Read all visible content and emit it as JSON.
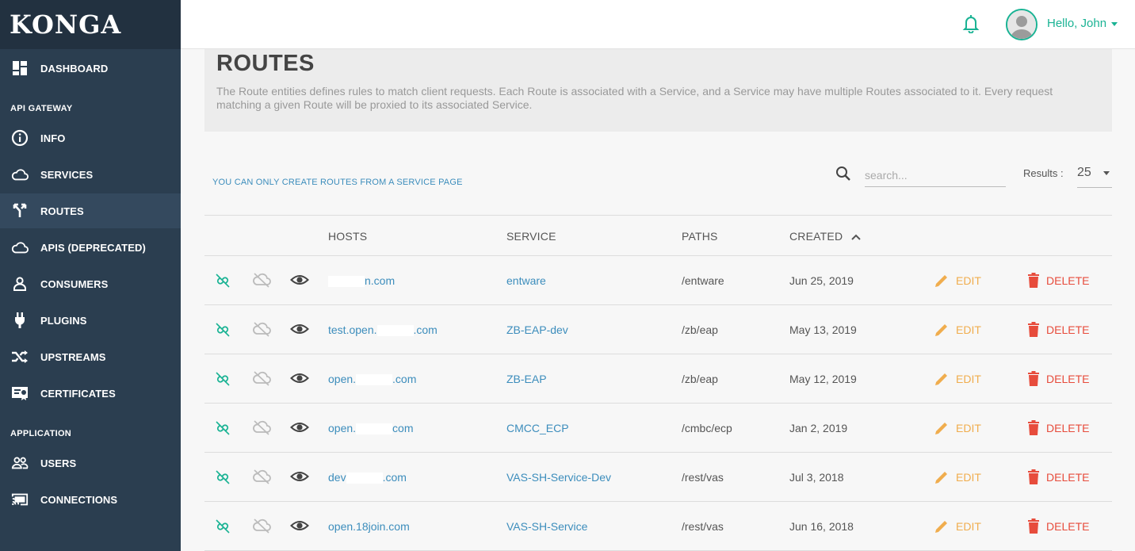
{
  "app": {
    "logo": "KONGA"
  },
  "sidebar": {
    "items": [
      {
        "label": "DASHBOARD",
        "icon": "dashboard-icon"
      },
      {
        "label": "INFO",
        "icon": "info-icon"
      },
      {
        "label": "SERVICES",
        "icon": "cloud-icon"
      },
      {
        "label": "ROUTES",
        "icon": "routes-icon",
        "active": true
      },
      {
        "label": "APIS (DEPRECATED)",
        "icon": "cloud-icon"
      },
      {
        "label": "CONSUMERS",
        "icon": "user-icon"
      },
      {
        "label": "PLUGINS",
        "icon": "plug-icon"
      },
      {
        "label": "UPSTREAMS",
        "icon": "shuffle-icon"
      },
      {
        "label": "CERTIFICATES",
        "icon": "certificate-icon"
      },
      {
        "label": "USERS",
        "icon": "users-icon"
      },
      {
        "label": "CONNECTIONS",
        "icon": "cast-icon"
      }
    ],
    "sections": {
      "api_gateway": "API GATEWAY",
      "application": "APPLICATION"
    }
  },
  "topbar": {
    "greeting": "Hello, John"
  },
  "page": {
    "title": "ROUTES",
    "description": "The Route entities defines rules to match client requests. Each Route is associated with a Service, and a Service may have multiple Routes associated to it. Every request matching a given Route will be proxied to its associated Service.",
    "notice": "YOU CAN ONLY CREATE ROUTES FROM A SERVICE PAGE"
  },
  "search": {
    "placeholder": "search..."
  },
  "results": {
    "label": "Results :",
    "value": "25"
  },
  "table": {
    "headers": {
      "hosts": "HOSTS",
      "service": "SERVICE",
      "paths": "PATHS",
      "created": "CREATED"
    },
    "edit_label": "EDIT",
    "delete_label": "DELETE",
    "rows": [
      {
        "host_pre": "",
        "host_post": "n.com",
        "service": "entware",
        "path": "/entware",
        "created": "Jun 25, 2019"
      },
      {
        "host_pre": "test.open.",
        "host_post": ".com",
        "service": "ZB-EAP-dev",
        "path": "/zb/eap",
        "created": "May 13, 2019"
      },
      {
        "host_pre": "open.",
        "host_post": ".com",
        "service": "ZB-EAP",
        "path": "/zb/eap",
        "created": "May 12, 2019"
      },
      {
        "host_pre": "open.",
        "host_post": "com",
        "service": "CMCC_ECP",
        "path": "/cmbc/ecp",
        "created": "Jan 2, 2019"
      },
      {
        "host_pre": "dev",
        "host_post": ".com",
        "service": "VAS-SH-Service-Dev",
        "path": "/rest/vas",
        "created": "Jul 3, 2018"
      },
      {
        "host_pre": "open.18join.com",
        "host_post": "",
        "service": "VAS-SH-Service",
        "path": "/rest/vas",
        "created": "Jun 16, 2018"
      }
    ]
  },
  "colors": {
    "sidebar": "#2b3e50",
    "accent": "#1ab394",
    "link": "#3c8dbc",
    "edit": "#f0ad4e",
    "delete": "#e74c3c"
  }
}
